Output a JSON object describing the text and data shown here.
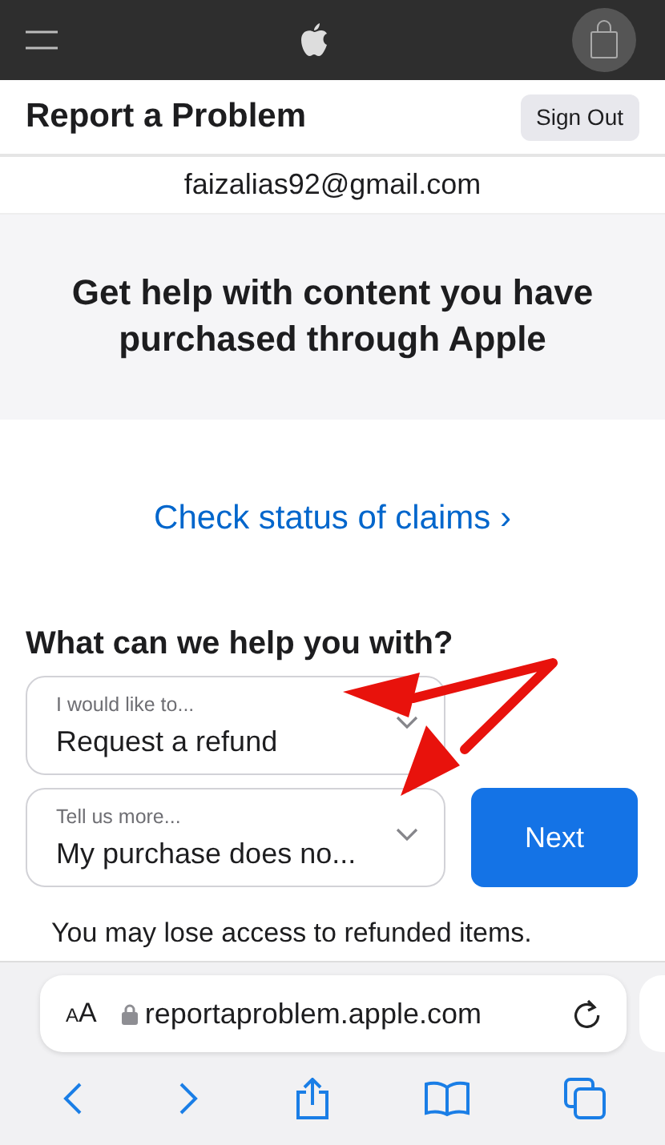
{
  "header": {
    "title": "Report a Problem",
    "sign_out": "Sign Out"
  },
  "account": {
    "email": "faizalias92@gmail.com"
  },
  "intro": {
    "heading": "Get help with content you have purchased through Apple"
  },
  "claims_link": "Check status of claims ›",
  "form": {
    "heading": "What can we help you with?",
    "selects": [
      {
        "label": "I would like to...",
        "value": "Request a refund"
      },
      {
        "label": "Tell us more...",
        "value": "My purchase does no..."
      }
    ],
    "next": "Next",
    "note": "You may lose access to refunded items."
  },
  "browser": {
    "text_size": "AA",
    "url": "reportaproblem.apple.com"
  }
}
